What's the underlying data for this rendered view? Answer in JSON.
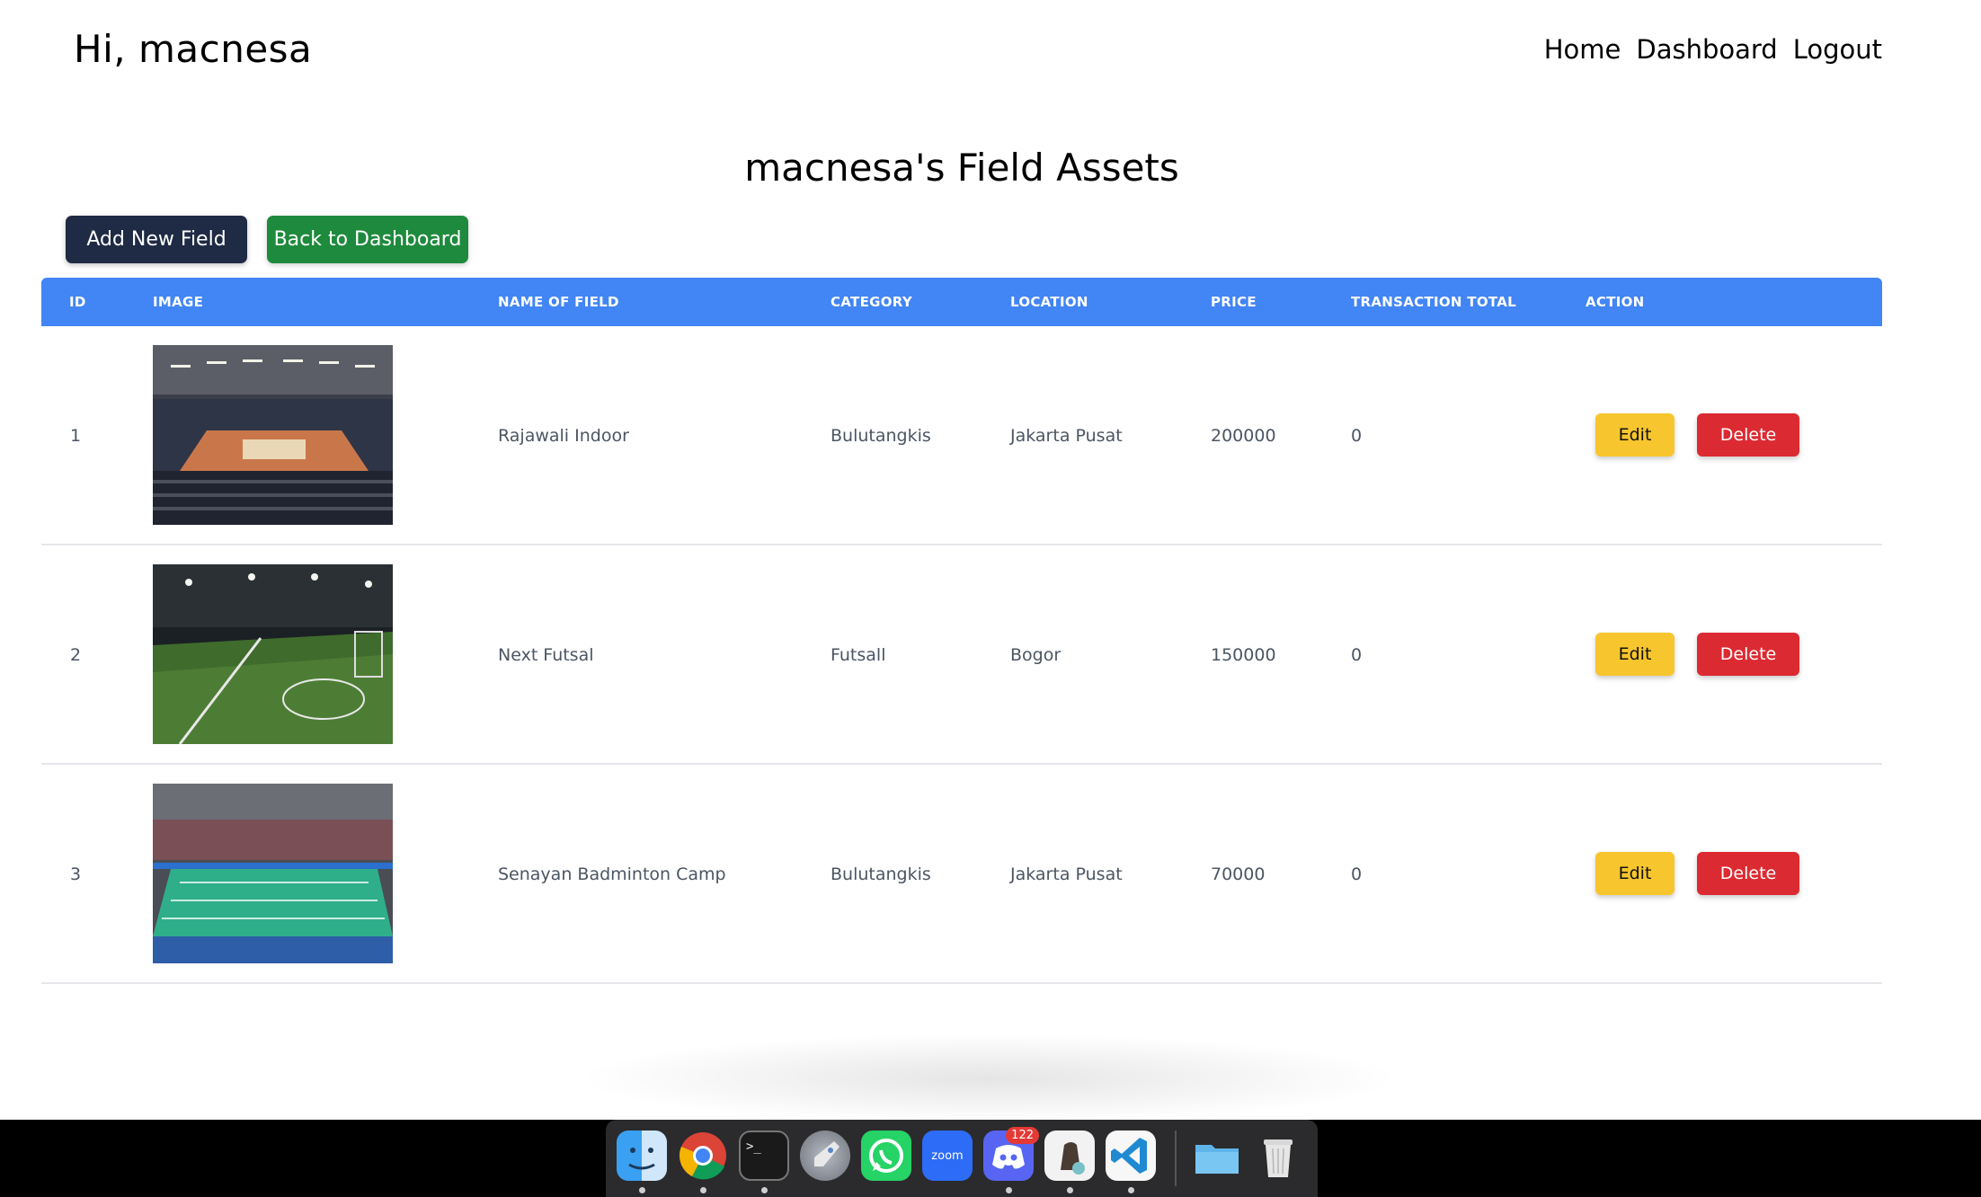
{
  "header": {
    "greeting": "Hi, macnesa",
    "nav": [
      "Home",
      "Dashboard",
      "Logout"
    ]
  },
  "page_title": "macnesa's Field Assets",
  "buttons": {
    "add": "Add New Field",
    "back": "Back to Dashboard"
  },
  "table": {
    "columns": [
      "ID",
      "IMAGE",
      "NAME OF FIELD",
      "CATEGORY",
      "LOCATION",
      "PRICE",
      "TRANSACTION TOTAL",
      "ACTION"
    ],
    "rows": [
      {
        "id": "1",
        "image": "indoor-arena-image",
        "name": "Rajawali Indoor",
        "category": "Bulutangkis",
        "location": "Jakarta Pusat",
        "price": "200000",
        "transactions": "0"
      },
      {
        "id": "2",
        "image": "futsal-field-image",
        "name": "Next Futsal",
        "category": "Futsall",
        "location": "Bogor",
        "price": "150000",
        "transactions": "0"
      },
      {
        "id": "3",
        "image": "badminton-hall-image",
        "name": "Senayan Badminton Camp",
        "category": "Bulutangkis",
        "location": "Jakarta Pusat",
        "price": "70000",
        "transactions": "0"
      }
    ],
    "edit_label": "Edit",
    "delete_label": "Delete"
  },
  "dock": {
    "apps": [
      "finder-icon",
      "chrome-icon",
      "terminal-icon",
      "launchpad-icon",
      "whatsapp-icon",
      "zoom-icon",
      "discord-icon",
      "app-icon",
      "vscode-icon",
      "folder-icon",
      "trash-icon"
    ],
    "discord_badge": "122",
    "zoom_label": "zoom"
  },
  "colors": {
    "header_bg": "#4285f4",
    "add_button": "#1f2a44",
    "back_button": "#1e8a3d",
    "edit_button": "#f7c52e",
    "delete_button": "#dc2a32"
  }
}
